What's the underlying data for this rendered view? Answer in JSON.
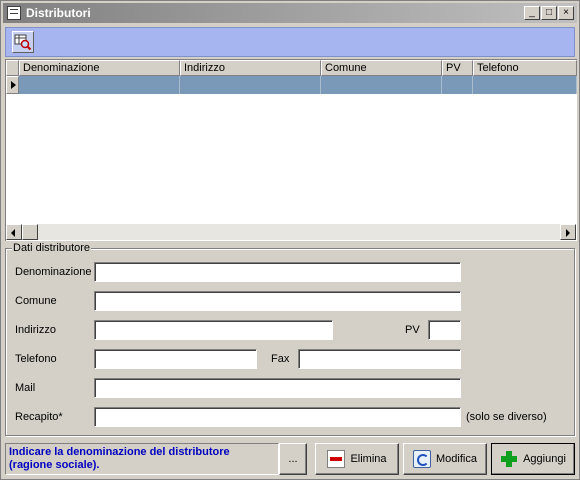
{
  "window": {
    "title": "Distributori",
    "minimize_label": "_",
    "maximize_label": "□",
    "close_label": "×"
  },
  "toolbar": {
    "tool_icon": "table-search-icon"
  },
  "grid": {
    "columns": [
      {
        "label": ""
      },
      {
        "label": "Denominazione"
      },
      {
        "label": "Indirizzo"
      },
      {
        "label": "Comune"
      },
      {
        "label": "PV"
      },
      {
        "label": "Telefono"
      }
    ]
  },
  "form": {
    "group_title": "Dati distributore",
    "denominazione_label": "Denominazione",
    "comune_label": "Comune",
    "indirizzo_label": "Indirizzo",
    "pv_label": "PV",
    "telefono_label": "Telefono",
    "fax_label": "Fax",
    "mail_label": "Mail",
    "recapito_label": "Recapito*",
    "recapito_note": "(solo se diverso)",
    "denominazione_value": "",
    "comune_value": "",
    "indirizzo_value": "",
    "pv_value": "",
    "telefono_value": "",
    "fax_value": "",
    "mail_value": "",
    "recapito_value": ""
  },
  "footer": {
    "hint": "Indicare la denominazione del distributore (ragione sociale).",
    "more_label": "...",
    "delete_label": "Elimina",
    "edit_label": "Modifica",
    "add_label": "Aggiungi"
  },
  "colors": {
    "toolbar_bg": "#a6b4f0",
    "selected_row": "#7a98b8",
    "hint_text": "#0000c0"
  }
}
